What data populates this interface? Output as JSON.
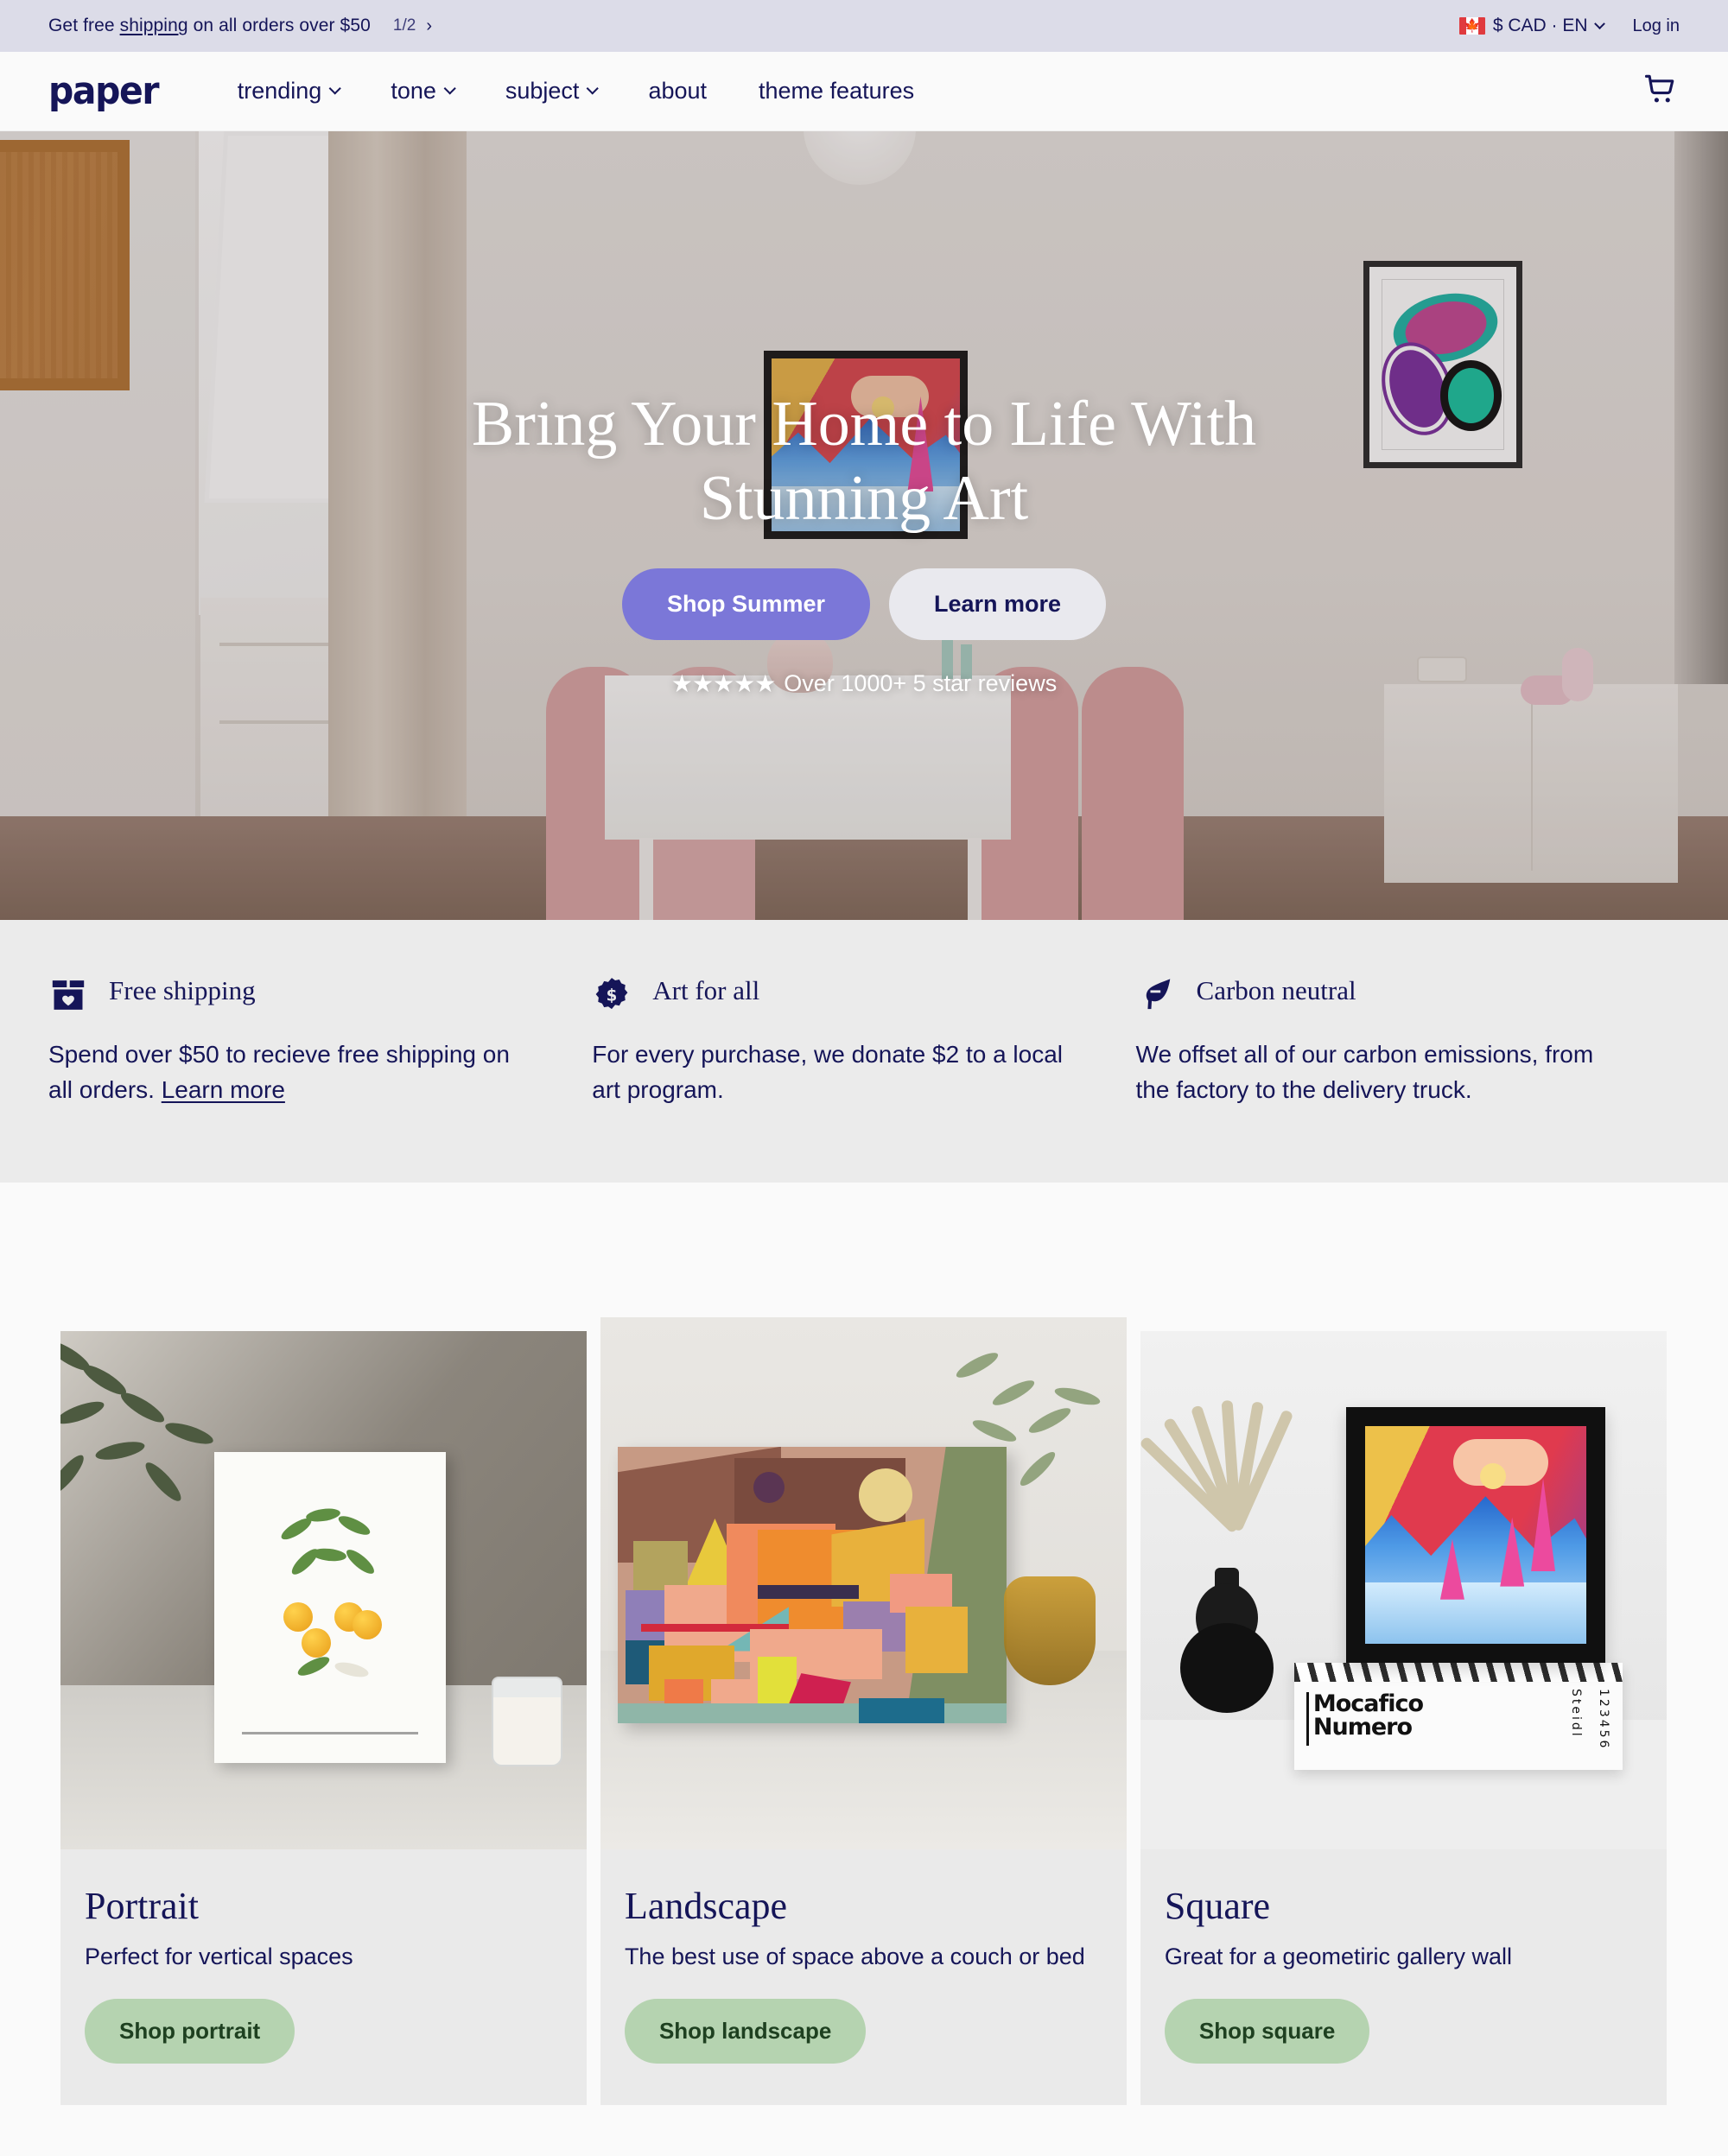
{
  "announcement": {
    "text_before": "Get free ",
    "link": "shipping",
    "text_after": " on all orders over $50",
    "counter": "1/2",
    "next_arrow": "›",
    "flag": "canada-flag",
    "currency": "$ CAD · EN",
    "login": "Log in"
  },
  "header": {
    "logo": "paper",
    "nav": [
      {
        "label": "trending",
        "has_dropdown": true
      },
      {
        "label": "tone",
        "has_dropdown": true
      },
      {
        "label": "subject",
        "has_dropdown": true
      },
      {
        "label": "about",
        "has_dropdown": false
      },
      {
        "label": "theme features",
        "has_dropdown": false
      }
    ],
    "cart_icon": "shopping-cart"
  },
  "hero": {
    "title": "Bring Your Home to Life With Stunning Art",
    "primary_button": "Shop Summer",
    "secondary_button": "Learn more",
    "stars": "★★★★★",
    "rating_text": "Over 1000+ 5 star reviews"
  },
  "benefits": [
    {
      "icon": "box-heart-icon",
      "title": "Free shipping",
      "body": "Spend over $50 to recieve free shipping on all orders. ",
      "link": "Learn more"
    },
    {
      "icon": "dollar-badge-icon",
      "title": "Art for all",
      "body": "For every purchase, we donate $2 to a local art program.",
      "link": ""
    },
    {
      "icon": "leaf-icon",
      "title": "Carbon neutral",
      "body": "We offset all of our carbon emissions, from the factory to the delivery truck.",
      "link": ""
    }
  ],
  "collections": [
    {
      "title": "Portrait",
      "description": "Perfect for vertical spaces",
      "button": "Shop portrait",
      "media": "botanical-citrus-canvas-photo"
    },
    {
      "title": "Landscape",
      "description": "The best use of space above a couch or bed",
      "button": "Shop landscape",
      "media": "abstract-geometric-canvas-photo"
    },
    {
      "title": "Square",
      "description": "Great for a geometiric gallery wall",
      "button": "Shop square",
      "media": "framed-winter-landscape-photo"
    }
  ],
  "book_cover": {
    "line1": "Mocafico",
    "line2": "Numero",
    "spine_publisher": "Steidl",
    "spine_numbers": "123456"
  },
  "colors": {
    "navy": "#151558",
    "announce_bg": "#dcdce8",
    "purple_button": "#7b77d8",
    "green_button": "#b5d3b0",
    "card_bg": "#eaeaea",
    "benefits_bg": "#ebebeb",
    "page_bg": "#fafafa"
  }
}
